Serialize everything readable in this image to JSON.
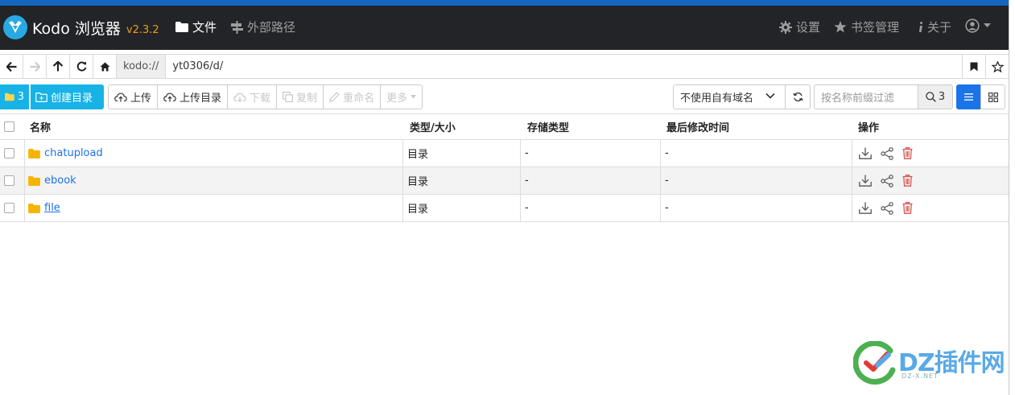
{
  "app": {
    "name": "Kodo 浏览器",
    "version": "v2.3.2"
  },
  "nav": {
    "files": "文件",
    "external_path": "外部路径",
    "settings": "设置",
    "bookmarks": "书签管理",
    "about": "关于"
  },
  "address": {
    "prefix": "kodo://",
    "path": "yt0306/d/"
  },
  "toolbar": {
    "folder_count": "3",
    "create_dir": "创建目录",
    "upload": "上传",
    "upload_dir": "上传目录",
    "download": "下载",
    "copy": "复制",
    "rename": "重命名",
    "more": "更多",
    "domain_select": "不使用自有域名",
    "filter_placeholder": "按名称前缀过滤",
    "search_count": "3"
  },
  "table": {
    "headers": {
      "name": "名称",
      "type_size": "类型/大小",
      "storage_class": "存储类型",
      "modified": "最后修改时间",
      "actions": "操作"
    },
    "rows": [
      {
        "name": "chatupload",
        "type": "目录",
        "storage": "-",
        "modified": "-"
      },
      {
        "name": "ebook",
        "type": "目录",
        "storage": "-",
        "modified": "-"
      },
      {
        "name": "file",
        "type": "目录",
        "storage": "-",
        "modified": "-"
      }
    ]
  },
  "watermark": {
    "text": "DZ插件网",
    "sub": "DZ-X.NET"
  },
  "colors": {
    "navbar": "#222427",
    "accent": "#17b3e6",
    "primary": "#1a73e8",
    "version": "#f39c12",
    "folder": "#f5b400",
    "delete": "#d9534f"
  }
}
